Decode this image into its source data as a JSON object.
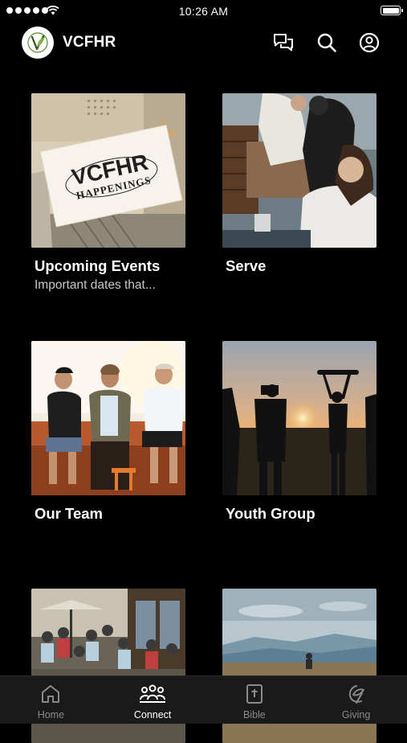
{
  "status_bar": {
    "time": "10:26 AM"
  },
  "header": {
    "brand": "VCFHR"
  },
  "cards": [
    {
      "title": "Upcoming Events",
      "subtitle": "Important dates that...",
      "image_text": {
        "line1": "VCFHR",
        "line2": "HAPPENINGS"
      }
    },
    {
      "title": "Serve",
      "subtitle": ""
    },
    {
      "title": "Our Team",
      "subtitle": ""
    },
    {
      "title": "Youth Group",
      "subtitle": ""
    },
    {
      "title": "",
      "subtitle": ""
    },
    {
      "title": "",
      "subtitle": ""
    }
  ],
  "tabs": [
    {
      "label": "Home",
      "icon": "home-icon"
    },
    {
      "label": "Connect",
      "icon": "people-icon",
      "active": true
    },
    {
      "label": "Bible",
      "icon": "bible-icon"
    },
    {
      "label": "Giving",
      "icon": "giving-icon"
    }
  ],
  "colors": {
    "background": "#000000",
    "tabbar": "#1a1a1a",
    "inactive_tab": "#8a8a8a",
    "subtitle": "#c8c8c8"
  }
}
